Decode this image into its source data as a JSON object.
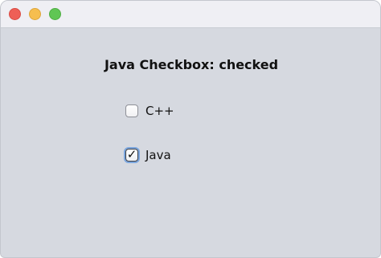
{
  "window": {
    "controls": [
      "close",
      "minimize",
      "zoom"
    ]
  },
  "status_label": "Java Checkbox: checked",
  "checkboxes": [
    {
      "label": "C++",
      "checked": false
    },
    {
      "label": "Java",
      "checked": true
    }
  ],
  "checkmark_glyph": "✓",
  "colors": {
    "close": "#ee5f57",
    "minimize": "#f6be4f",
    "zoom": "#60c654",
    "content_bg": "#d6d9e0",
    "focus_ring": "#7ba6de"
  }
}
